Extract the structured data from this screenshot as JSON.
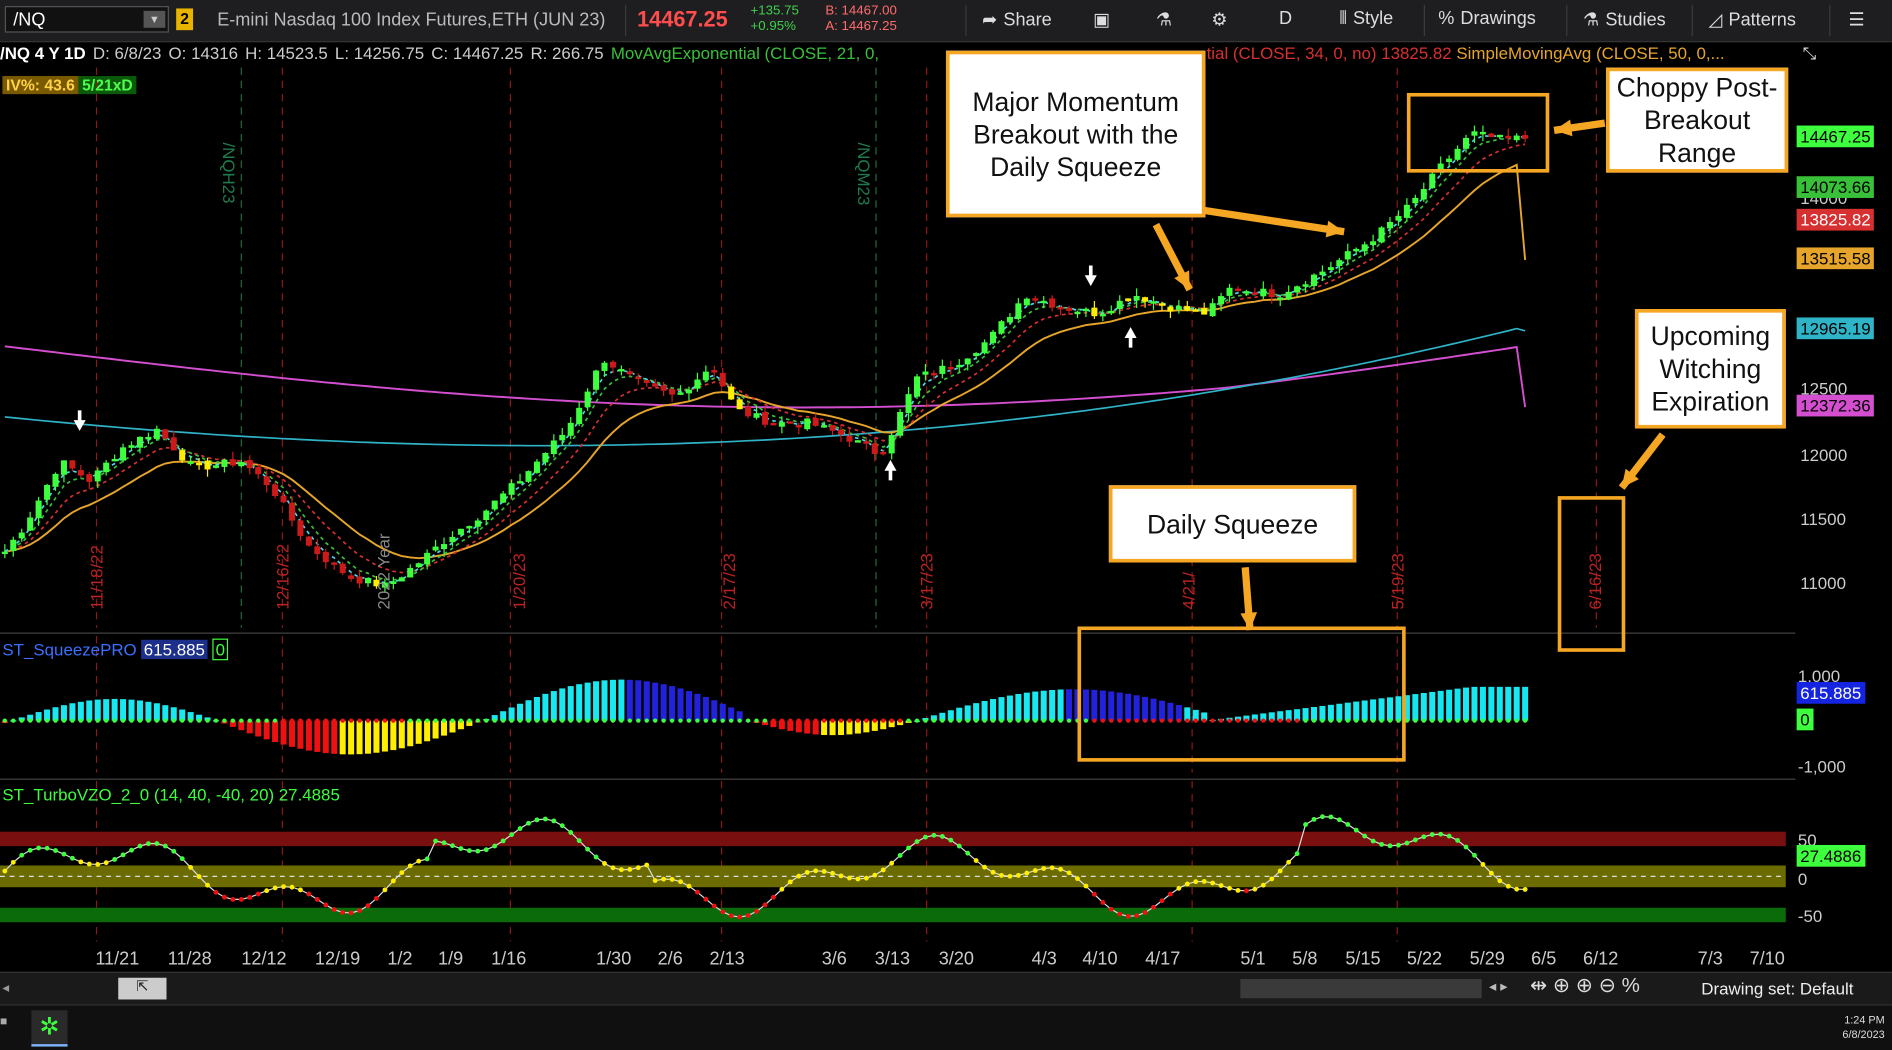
{
  "toolbar": {
    "symbol": "/NQ",
    "link_badge": "2",
    "description": "E-mini Nasdaq 100 Index Futures,ETH (JUN 23)",
    "last": "14467.25",
    "change": "+135.75",
    "change_pct": "+0.95%",
    "bid": "B: 14467.00",
    "ask": "A: 14467.25",
    "share": "Share",
    "timeframe": "D",
    "style": "Style",
    "drawings": "Drawings",
    "studies": "Studies",
    "patterns": "Patterns"
  },
  "study_header": {
    "symbol_period": "/NQ 4 Y 1D",
    "date": "D: 6/8/23",
    "open": "O: 14316",
    "high": "H: 14523.5",
    "low": "L: 14256.75",
    "close": "C: 14467.25",
    "range": "R: 266.75",
    "ema21": "MovAvgExponential (CLOSE, 21, 0,",
    "ema34_tail": "tial (CLOSE, 34, 0, no)",
    "ema34_value": "13825.82",
    "sma50": "SimpleMovingAvg (CLOSE, 50, 0,...",
    "iv": "IV%: 43.6",
    "ivx": "5/21xD"
  },
  "colors": {
    "up_candle": "#3dff3d",
    "down_candle": "#cc1a1a",
    "squeeze_candle": "#ffee00",
    "ema8": "#4fd4f0",
    "ema21": "#39c039",
    "ema34": "#d73030",
    "sma50": "#e6a52a",
    "sma100": "#2fb3c7",
    "sma200": "#d44fd0",
    "callout_border": "#f5a623"
  },
  "price_axis": {
    "ticks": [
      "14000",
      "12500",
      "12000",
      "11500",
      "11000"
    ],
    "labels": [
      {
        "text": "14467.25",
        "bg": "#3dff3d",
        "fg": "#000"
      },
      {
        "text": "14073.66",
        "bg": "#39c039",
        "fg": "#000"
      },
      {
        "text": "13825.82",
        "bg": "#d73030",
        "fg": "#fff"
      },
      {
        "text": "13515.58",
        "bg": "#e6a52a",
        "fg": "#000"
      },
      {
        "text": "12965.19",
        "bg": "#2fb3c7",
        "fg": "#000"
      },
      {
        "text": "12372.36",
        "bg": "#d44fd0",
        "fg": "#000"
      }
    ]
  },
  "vertical_dates": [
    "11/18/22",
    "12/16/22",
    "2022 Year",
    "1/20/23",
    "2/17/23",
    "3/17/23",
    "4/21/",
    "5/19/23",
    "6/16/23"
  ],
  "expiry_labels": [
    "/NQH23",
    "/NQM23"
  ],
  "squeeze_panel": {
    "name": "ST_SqueezePRO",
    "value": "615.885",
    "flag": "0",
    "scale_top": "1,000",
    "scale_bottom": "-1,000"
  },
  "vzo_panel": {
    "name": "ST_TurboVZO_2_0 (14, 40, -40, 20)",
    "value": "27.4885",
    "axis_value": "27.4886",
    "scale": [
      "50",
      "0",
      "-50"
    ]
  },
  "x_axis": [
    "11/21",
    "11/28",
    "12/12",
    "12/19",
    "1/2",
    "1/9",
    "1/16",
    "1/30",
    "2/6",
    "2/13",
    "3/6",
    "3/13",
    "3/20",
    "4/3",
    "4/10",
    "4/17",
    "5/1",
    "5/8",
    "5/15",
    "5/22",
    "5/29",
    "6/5",
    "6/12",
    "7/3",
    "7/10"
  ],
  "callouts": {
    "momentum": "Major Momentum Breakout with the Daily Squeeze",
    "choppy": "Choppy Post-Breakout Range",
    "witching": "Upcoming Witching Expiration",
    "squeeze": "Daily Squeeze"
  },
  "bottom": {
    "drawing_set": "Drawing set: Default",
    "time": "1:24 PM",
    "date": "6/8/2023"
  },
  "chart_data": {
    "type": "candlestick",
    "x_dates": [
      "11/21",
      "11/28",
      "12/12",
      "12/19",
      "1/2",
      "1/9",
      "1/16",
      "1/30",
      "2/6",
      "2/13",
      "3/6",
      "3/13",
      "3/20",
      "4/3",
      "4/10",
      "4/17",
      "5/1",
      "5/8",
      "5/15",
      "5/22",
      "5/29",
      "6/5"
    ],
    "close_approx": [
      12000,
      11850,
      11600,
      11100,
      11000,
      11300,
      11750,
      12400,
      12650,
      12450,
      12250,
      12200,
      12650,
      13100,
      13050,
      13000,
      13200,
      13400,
      13700,
      14200,
      14500,
      14467.25
    ],
    "last_close": 14467.25,
    "ylim": [
      10900,
      14700
    ],
    "moving_averages": [
      {
        "name": "EMA 21",
        "last": 14073.66
      },
      {
        "name": "EMA 34",
        "last": 13825.82
      },
      {
        "name": "SMA 50",
        "last": 13515.58
      },
      {
        "name": "SMA 100",
        "last": 12965.19
      },
      {
        "name": "SMA 200",
        "last": 12372.36
      }
    ],
    "squeeze_histogram_last": 615.885,
    "vzo_last": 27.4885
  }
}
